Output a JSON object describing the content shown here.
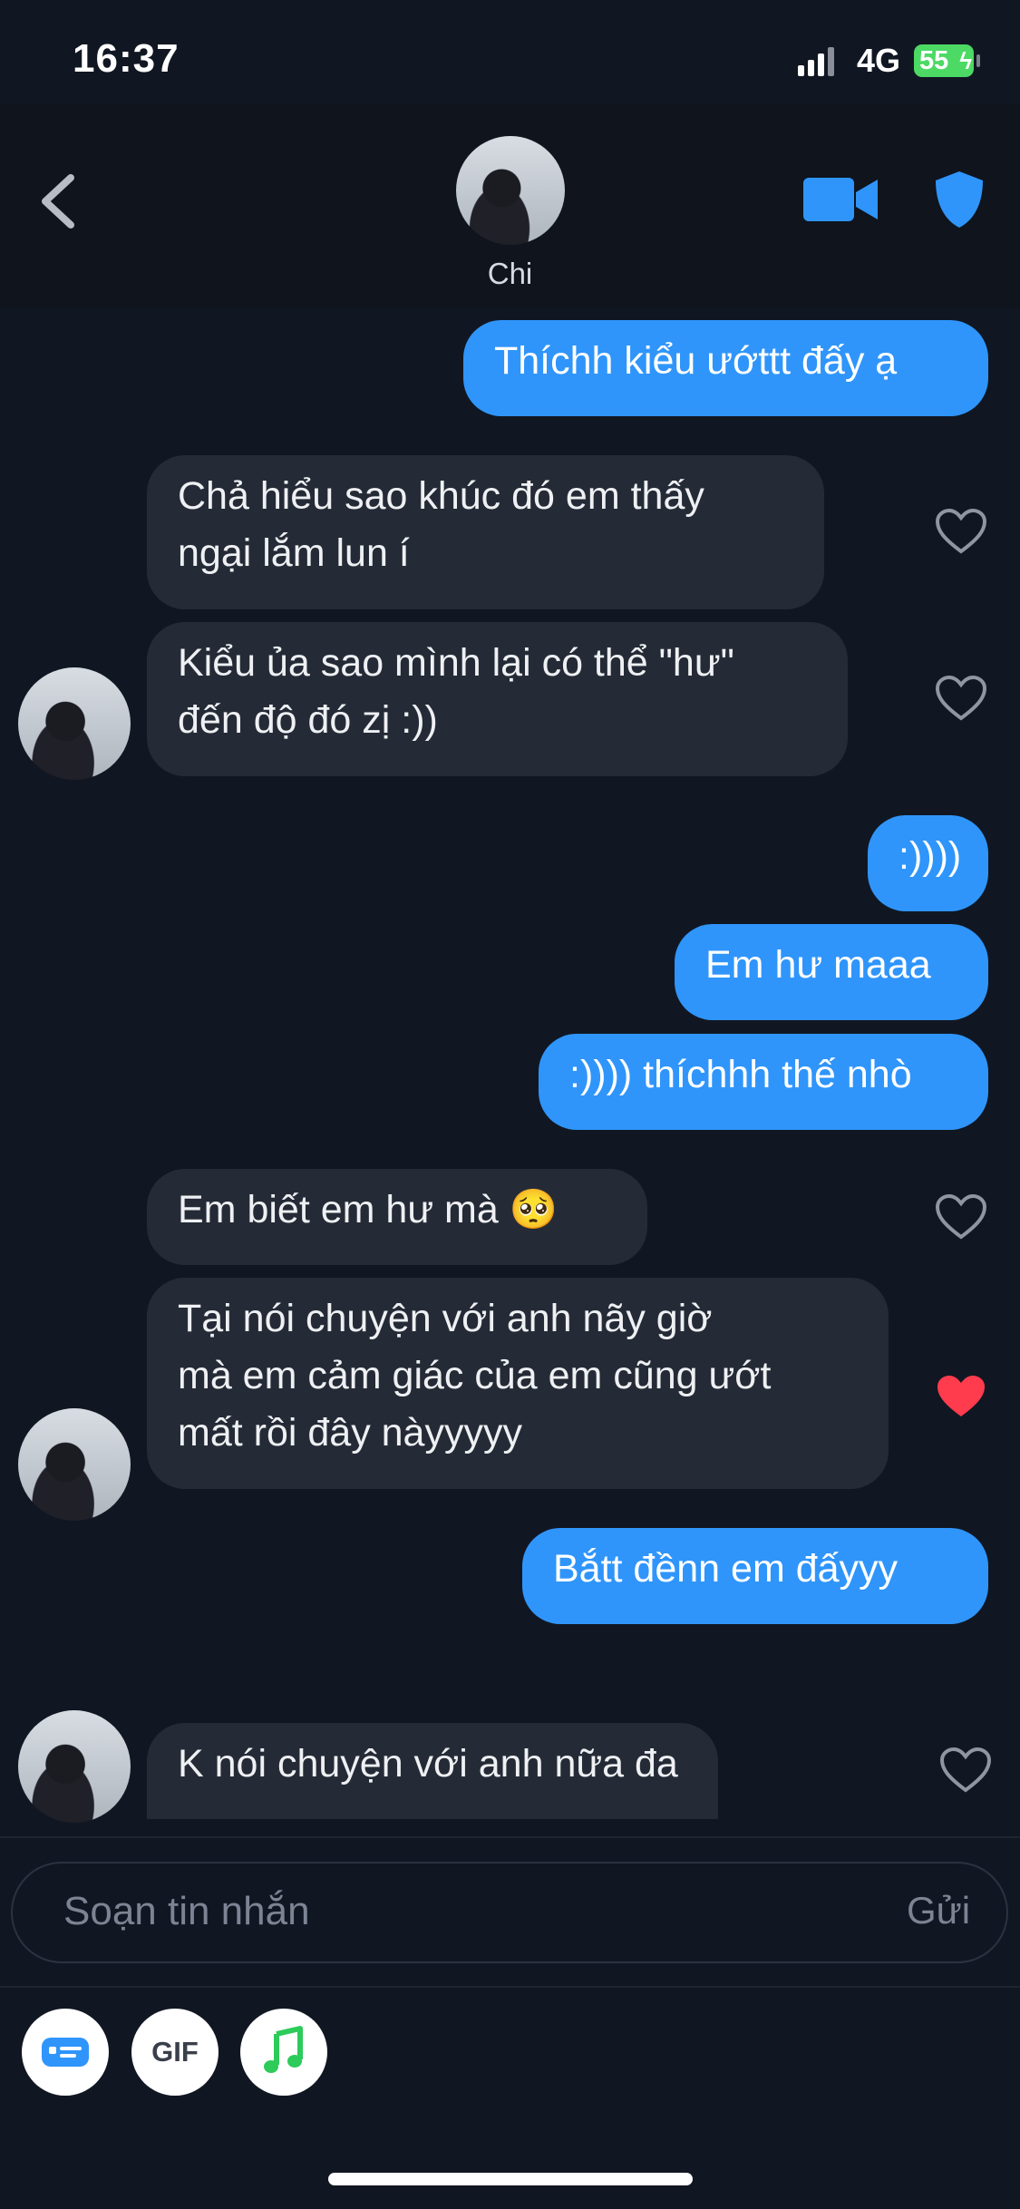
{
  "status_bar": {
    "time": "16:37",
    "network": "4G",
    "battery": "55"
  },
  "header": {
    "contact_name": "Chi"
  },
  "messages": [
    {
      "text": "Thíchh kiểu ướttt đấy ạ"
    },
    {
      "text": "Chả hiểu sao khúc đó em thấy\nngại lắm lun í"
    },
    {
      "text": "Kiểu ủa sao mình lại có thể \"hư\"\nđến độ đó zị :))"
    },
    {
      "text": ":))))"
    },
    {
      "text": "Em hư maaa"
    },
    {
      "text": ":)))) thíchhh thế nhò"
    },
    {
      "text": "Em biết em hư mà 🥺"
    },
    {
      "text": "Tại nói chuyện với anh nãy giờ\nmà em cảm giác của em cũng ướt\nmất rồi đây nàyyyyy",
      "liked": true
    },
    {
      "text": "Bắtt đềnn em đấyyy"
    },
    {
      "text": "K nói chuyện với anh nữa đa"
    }
  ],
  "composer": {
    "placeholder": "Soạn tin nhắn",
    "send_label": "Gửi"
  },
  "toolbar": {
    "gif_label": "GIF"
  },
  "colors": {
    "accent": "#2f95fb",
    "liked_heart": "#ff3b4e",
    "background": "#111722"
  }
}
